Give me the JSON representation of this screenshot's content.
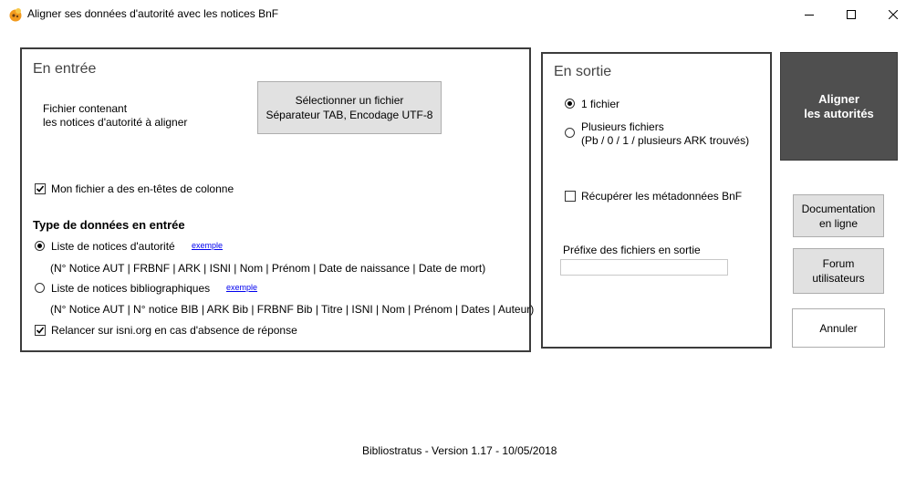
{
  "window": {
    "title": "Aligner ses données d'autorité avec les notices BnF",
    "icon": "bibliostratus-app-icon",
    "controls": [
      "minimize-icon",
      "maximize-icon",
      "close-icon"
    ]
  },
  "input_panel": {
    "title": "En entrée",
    "file_label_line1": "Fichier contenant",
    "file_label_line2": "les notices d'autorité à aligner",
    "select_file_line1": "Sélectionner un fichier",
    "select_file_line2": "Séparateur TAB, Encodage UTF-8",
    "headers_checkbox": {
      "label": "Mon fichier a des en-têtes de colonne",
      "checked": true
    },
    "type_heading": "Type de données en entrée",
    "type_options": [
      {
        "label": "Liste de notices d'autorité",
        "example_link": "exemple",
        "columns": "(N° Notice AUT | FRBNF | ARK | ISNI | Nom | Prénom | Date de naissance | Date de mort)",
        "selected": true
      },
      {
        "label": "Liste de notices bibliographiques",
        "example_link": "exemple",
        "columns": "(N° Notice AUT | N° notice BIB | ARK Bib | FRBNF Bib | Titre | ISNI | Nom | Prénom | Dates | Auteur)",
        "selected": false
      }
    ],
    "isni_checkbox": {
      "label": "Relancer sur isni.org en cas d'absence de réponse",
      "checked": true
    }
  },
  "output_panel": {
    "title": "En sortie",
    "options": [
      {
        "line1": "1 fichier",
        "line2": "",
        "selected": true
      },
      {
        "line1": "Plusieurs fichiers",
        "line2": "(Pb / 0 / 1 / plusieurs ARK trouvés)",
        "selected": false
      }
    ],
    "metadata_checkbox": {
      "label": "Récupérer les métadonnées BnF",
      "checked": false
    },
    "prefix_label": "Préfixe des fichiers en sortie",
    "prefix_value": ""
  },
  "actions": {
    "align_line1": "Aligner",
    "align_line2": "les autorités",
    "doc_line1": "Documentation",
    "doc_line2": "en ligne",
    "forum_line1": "Forum",
    "forum_line2": "utilisateurs",
    "cancel": "Annuler"
  },
  "footer": {
    "version": "Bibliostratus - Version 1.17 - 10/05/2018"
  },
  "colors": {
    "align_button_bg": "#4f4f4f",
    "panel_border": "#3c3c3c",
    "link": "#0000ee"
  }
}
